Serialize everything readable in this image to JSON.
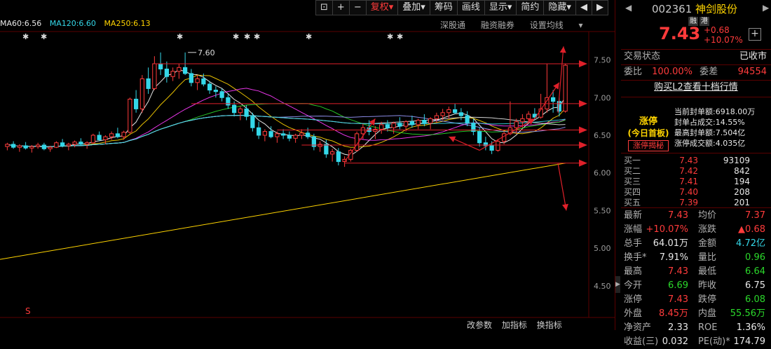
{
  "toolbar": {
    "icons": [
      "lock-icon",
      "plus-icon",
      "minus-icon"
    ],
    "buttons": [
      {
        "label": "复权",
        "dropdown": true,
        "active": true
      },
      {
        "label": "叠加",
        "dropdown": true
      },
      {
        "label": "筹码"
      },
      {
        "label": "画线"
      },
      {
        "label": "显示",
        "dropdown": true
      },
      {
        "label": "简约"
      },
      {
        "label": "隐藏",
        "dropdown": true
      }
    ],
    "scroll_left": "◀",
    "scroll_right": "▶"
  },
  "ma_legend": [
    {
      "label": "MA60:6.56",
      "color": "#e8e8e8"
    },
    {
      "label": "MA120:6.60",
      "color": "#34d7e8"
    },
    {
      "label": "MA250:6.13",
      "color": "#ffd400"
    }
  ],
  "top_links": [
    "深股通",
    "融资融券",
    "设置均线"
  ],
  "bottom_links": [
    "改参数",
    "加指标",
    "换指标"
  ],
  "colors": {
    "up": "#ff3b3b",
    "down": "#34d7e8",
    "arrow": "#e0202a",
    "grid": "#5a0000"
  },
  "chart_data": {
    "type": "candlestick",
    "y_ticks": [
      "7.50",
      "7.00",
      "6.50",
      "6.00",
      "5.50",
      "5.00",
      "4.50"
    ],
    "ylim": [
      4.2,
      7.85
    ],
    "max_annotation": "7.60",
    "candles": [
      [
        6.35,
        6.4,
        6.3,
        6.38
      ],
      [
        6.38,
        6.42,
        6.32,
        6.34
      ],
      [
        6.34,
        6.38,
        6.28,
        6.36
      ],
      [
        6.36,
        6.41,
        6.31,
        6.33
      ],
      [
        6.33,
        6.37,
        6.27,
        6.35
      ],
      [
        6.35,
        6.4,
        6.32,
        6.37
      ],
      [
        6.37,
        6.4,
        6.3,
        6.32
      ],
      [
        6.32,
        6.36,
        6.28,
        6.34
      ],
      [
        6.34,
        6.42,
        6.33,
        6.4
      ],
      [
        6.4,
        6.45,
        6.34,
        6.36
      ],
      [
        6.36,
        6.4,
        6.3,
        6.38
      ],
      [
        6.38,
        6.43,
        6.34,
        6.41
      ],
      [
        6.41,
        6.46,
        6.36,
        6.38
      ],
      [
        6.38,
        6.42,
        6.32,
        6.4
      ],
      [
        6.4,
        6.52,
        6.38,
        6.5
      ],
      [
        6.5,
        6.55,
        6.42,
        6.44
      ],
      [
        6.44,
        6.5,
        6.38,
        6.48
      ],
      [
        6.48,
        6.55,
        6.44,
        6.52
      ],
      [
        6.52,
        6.6,
        6.46,
        6.48
      ],
      [
        6.48,
        6.56,
        6.44,
        6.54
      ],
      [
        6.54,
        7.0,
        6.52,
        6.98
      ],
      [
        6.98,
        7.1,
        6.8,
        6.85
      ],
      [
        6.85,
        7.3,
        6.8,
        7.25
      ],
      [
        7.25,
        7.4,
        7.05,
        7.12
      ],
      [
        7.12,
        7.55,
        7.1,
        7.45
      ],
      [
        7.45,
        7.6,
        7.3,
        7.38
      ],
      [
        7.38,
        7.48,
        7.2,
        7.28
      ],
      [
        7.28,
        7.4,
        7.22,
        7.35
      ],
      [
        7.35,
        7.45,
        7.25,
        7.4
      ],
      [
        7.4,
        7.6,
        7.3,
        7.32
      ],
      [
        7.32,
        7.38,
        7.15,
        7.2
      ],
      [
        7.2,
        7.3,
        7.1,
        7.25
      ],
      [
        7.25,
        7.32,
        7.15,
        7.18
      ],
      [
        7.18,
        7.22,
        7.05,
        7.1
      ],
      [
        7.1,
        7.15,
        7.0,
        7.08
      ],
      [
        7.08,
        7.12,
        6.95,
        7.0
      ],
      [
        7.0,
        7.05,
        6.85,
        6.9
      ],
      [
        6.9,
        6.95,
        6.75,
        6.8
      ],
      [
        6.8,
        6.88,
        6.7,
        6.85
      ],
      [
        6.85,
        6.9,
        6.7,
        6.75
      ],
      [
        6.75,
        6.8,
        6.55,
        6.6
      ],
      [
        6.6,
        6.68,
        6.45,
        6.5
      ],
      [
        6.5,
        6.58,
        6.42,
        6.55
      ],
      [
        6.55,
        6.62,
        6.46,
        6.48
      ],
      [
        6.48,
        6.55,
        6.4,
        6.52
      ],
      [
        6.52,
        6.58,
        6.45,
        6.5
      ],
      [
        6.5,
        6.55,
        6.42,
        6.46
      ],
      [
        6.46,
        6.52,
        6.4,
        6.5
      ],
      [
        6.5,
        6.58,
        6.45,
        6.53
      ],
      [
        6.53,
        6.6,
        6.45,
        6.48
      ],
      [
        6.48,
        6.52,
        6.3,
        6.35
      ],
      [
        6.35,
        6.42,
        6.28,
        6.38
      ],
      [
        6.38,
        6.44,
        6.2,
        6.25
      ],
      [
        6.25,
        6.32,
        6.15,
        6.28
      ],
      [
        6.28,
        6.33,
        6.1,
        6.15
      ],
      [
        6.15,
        6.22,
        6.08,
        6.18
      ],
      [
        6.18,
        6.32,
        6.15,
        6.3
      ],
      [
        6.3,
        6.55,
        6.28,
        6.52
      ],
      [
        6.52,
        6.65,
        6.45,
        6.6
      ],
      [
        6.6,
        6.7,
        6.5,
        6.55
      ],
      [
        6.55,
        6.62,
        6.45,
        6.58
      ],
      [
        6.58,
        6.68,
        6.52,
        6.64
      ],
      [
        6.64,
        6.7,
        6.55,
        6.6
      ],
      [
        6.6,
        6.68,
        6.52,
        6.66
      ],
      [
        6.66,
        6.74,
        6.58,
        6.62
      ],
      [
        6.62,
        6.7,
        6.55,
        6.68
      ],
      [
        6.68,
        6.76,
        6.6,
        6.64
      ],
      [
        6.64,
        6.72,
        6.58,
        6.7
      ],
      [
        6.7,
        6.78,
        6.62,
        6.66
      ],
      [
        6.66,
        6.74,
        6.58,
        6.72
      ],
      [
        6.72,
        6.8,
        6.66,
        6.76
      ],
      [
        6.76,
        6.85,
        6.7,
        6.8
      ],
      [
        6.8,
        6.88,
        6.72,
        6.84
      ],
      [
        6.84,
        6.92,
        6.78,
        6.8
      ],
      [
        6.8,
        6.86,
        6.7,
        6.76
      ],
      [
        6.76,
        6.82,
        6.62,
        6.66
      ],
      [
        6.66,
        6.72,
        6.5,
        6.55
      ],
      [
        6.55,
        6.6,
        6.35,
        6.4
      ],
      [
        6.4,
        6.48,
        6.3,
        6.36
      ],
      [
        6.36,
        6.42,
        6.25,
        6.3
      ],
      [
        6.3,
        6.45,
        6.28,
        6.42
      ],
      [
        6.42,
        6.55,
        6.38,
        6.52
      ],
      [
        6.52,
        6.95,
        6.5,
        6.6
      ],
      [
        6.6,
        6.72,
        6.52,
        6.68
      ],
      [
        6.68,
        6.78,
        6.6,
        6.72
      ],
      [
        6.72,
        6.82,
        6.65,
        6.78
      ],
      [
        6.78,
        6.86,
        6.7,
        6.74
      ],
      [
        6.74,
        7.05,
        6.72,
        6.85
      ],
      [
        6.85,
        7.45,
        6.8,
        7.0
      ],
      [
        7.0,
        7.1,
        6.8,
        6.95
      ],
      [
        6.95,
        7.0,
        6.75,
        6.82
      ],
      [
        6.82,
        7.45,
        6.8,
        7.43
      ]
    ]
  },
  "arrows": {
    "up_target": "7.50",
    "down_target": "5.50"
  },
  "stock": {
    "code": "002361",
    "name": "神剑股份",
    "tags": [
      "融",
      "港"
    ],
    "price": "7.43",
    "change": "+0.68",
    "change_pct": "+10.07%",
    "plus_icon": "+"
  },
  "status": {
    "label": "交易状态",
    "value": "已收市"
  },
  "commission": {
    "ratio_label": "委比",
    "ratio_value": "100.00%",
    "diff_label": "委差",
    "diff_value": "94554"
  },
  "l2_link": "购买L2查看十档行情",
  "limit_up": {
    "badge_title": "涨停",
    "badge_sub": "(今日首板)",
    "badge_button": "涨停揭秘",
    "items": [
      {
        "label": "当前封单额:",
        "value": "6918.00万"
      },
      {
        "label": "封单占成交:",
        "value": "14.55%"
      },
      {
        "label": "最高封单额:",
        "value": "7.504亿"
      },
      {
        "label": "涨停成交额:",
        "value": "4.035亿"
      }
    ]
  },
  "order_book": [
    {
      "label": "买一",
      "price": "7.43",
      "volume": "93109"
    },
    {
      "label": "买二",
      "price": "7.42",
      "volume": "842"
    },
    {
      "label": "买三",
      "price": "7.41",
      "volume": "194"
    },
    {
      "label": "买四",
      "price": "7.40",
      "volume": "208"
    },
    {
      "label": "买五",
      "price": "7.39",
      "volume": "201"
    }
  ],
  "quote": [
    {
      "l1": "最新",
      "v1": "7.43",
      "c1": "red",
      "l2": "均价",
      "v2": "7.37",
      "c2": "red"
    },
    {
      "l1": "涨幅",
      "v1": "+10.07%",
      "c1": "red",
      "l2": "涨跌",
      "v2": "▲0.68",
      "c2": "red"
    },
    {
      "l1": "总手",
      "v1": "64.01万",
      "c1": "white",
      "l2": "金额",
      "v2": "4.72亿",
      "c2": "cyan"
    },
    {
      "l1": "换手*",
      "v1": "7.91%",
      "c1": "white",
      "l2": "量比",
      "v2": "0.96",
      "c2": "green"
    },
    {
      "l1": "最高",
      "v1": "7.43",
      "c1": "red",
      "l2": "最低",
      "v2": "6.64",
      "c2": "green"
    },
    {
      "l1": "今开",
      "v1": "6.69",
      "c1": "green",
      "l2": "昨收",
      "v2": "6.75",
      "c2": "white"
    },
    {
      "l1": "涨停",
      "v1": "7.43",
      "c1": "red",
      "l2": "跌停",
      "v2": "6.08",
      "c2": "green"
    },
    {
      "l1": "外盘",
      "v1": "8.45万",
      "c1": "red",
      "l2": "内盘",
      "v2": "55.56万",
      "c2": "green"
    },
    {
      "l1": "净资产",
      "v1": "2.33",
      "c1": "white",
      "l2": "ROE",
      "v2": "1.36%",
      "c2": "white"
    },
    {
      "l1": "收益(三)",
      "v1": "0.032",
      "c1": "white",
      "l2": "PE(动)*",
      "v2": "174.79",
      "c2": "white"
    }
  ]
}
